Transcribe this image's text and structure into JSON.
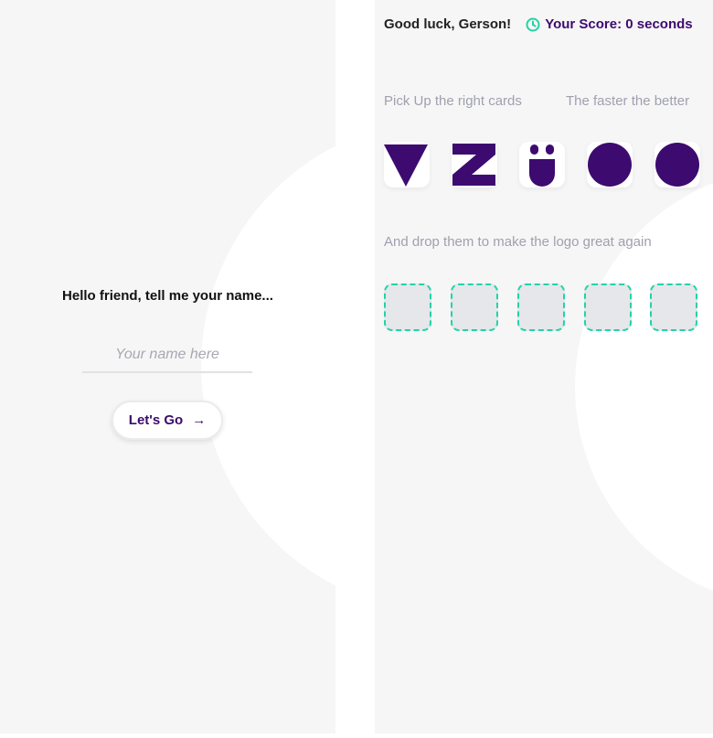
{
  "login": {
    "prompt": "Hello friend, tell me your name...",
    "name_placeholder": "Your name here",
    "name_value": "",
    "go_label": "Let's Go",
    "go_icon": "arrow-right-icon"
  },
  "game": {
    "greeting": "Good luck, Gerson!",
    "score_label": "Your Score: 0 seconds",
    "score_icon": "clock-icon",
    "hint_pick": "Pick Up the right cards",
    "hint_fast": "The faster the better",
    "hint_drop": "And drop them to make the logo great again",
    "cards": [
      {
        "icon": "triangle-card-icon"
      },
      {
        "icon": "z-card-icon"
      },
      {
        "icon": "u-umlaut-card-icon"
      },
      {
        "icon": "circle-card-icon"
      },
      {
        "icon": "circle-card-icon"
      }
    ],
    "drop_slots": 5
  },
  "colors": {
    "brand_purple": "#3d0a70",
    "accent_green": "#22d3a6",
    "panel_bg": "#f6f6f6",
    "slot_bg": "#e5e7eb"
  }
}
